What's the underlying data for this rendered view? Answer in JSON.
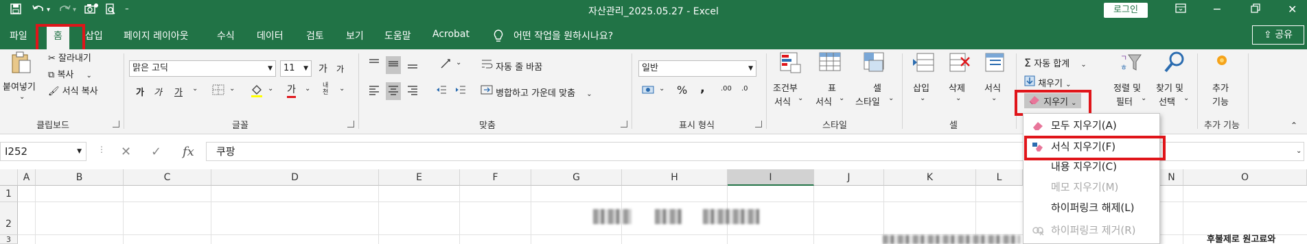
{
  "window": {
    "title": "자산관리_2025.05.27  -  Excel",
    "login_label": "로그인",
    "share_label": "공유"
  },
  "tabs": [
    "파일",
    "홈",
    "삽입",
    "페이지 레이아웃",
    "수식",
    "데이터",
    "검토",
    "보기",
    "도움말",
    "Acrobat"
  ],
  "tell_me": "어떤 작업을 원하시나요?",
  "ribbon": {
    "clipboard": {
      "paste": "붙여넣기",
      "cut": "잘라내기",
      "copy": "복사",
      "format_painter": "서식 복사",
      "label": "클립보드"
    },
    "font": {
      "name": "맑은 고딕",
      "size": "11",
      "grow": "가",
      "shrink": "가",
      "bold": "가",
      "italic": "가",
      "underline": "가",
      "font_color": "가",
      "phonetic": "내천",
      "label": "글꼴"
    },
    "alignment": {
      "wrap": "자동 줄 바꿈",
      "merge": "병합하고 가운데 맞춤",
      "label": "맞춤"
    },
    "number": {
      "format": "일반",
      "percent": "%",
      "comma": ",",
      "inc": ".00",
      "dec": ".0",
      "label": "표시 형식"
    },
    "styles": {
      "conditional": [
        "조건부",
        "서식"
      ],
      "table": [
        "표",
        "서식"
      ],
      "cell": [
        "셀",
        "스타일"
      ],
      "label": "스타일"
    },
    "cells": {
      "insert": "삽입",
      "delete": "삭제",
      "format": "서식",
      "label": "셀"
    },
    "editing": {
      "autosum": "자동 합계",
      "fill": "채우기",
      "clear": "지우기",
      "sort": [
        "정렬 및",
        "필터"
      ],
      "find": [
        "찾기 및",
        "선택"
      ]
    },
    "addins": {
      "button": [
        "추가",
        "기능"
      ],
      "label": "추가 기능"
    }
  },
  "formula_bar": {
    "name_box": "I252",
    "fx": "fx",
    "content": "쿠팡"
  },
  "columns": [
    "A",
    "B",
    "C",
    "D",
    "E",
    "F",
    "G",
    "H",
    "I",
    "J",
    "K",
    "L",
    "N",
    "O"
  ],
  "rows": [
    "1",
    "2",
    "3"
  ],
  "cell_text": "후불제로 원고료와",
  "clear_menu": {
    "items": [
      {
        "label": "모두 지우기(A)",
        "enabled": true
      },
      {
        "label": "서식 지우기(F)",
        "enabled": true
      },
      {
        "label": "내용 지우기(C)",
        "enabled": true
      },
      {
        "label": "메모 지우기(M)",
        "enabled": false
      },
      {
        "label": "하이퍼링크 해제(L)",
        "enabled": true
      },
      {
        "label": "하이퍼링크 제거(R)",
        "enabled": false
      }
    ]
  },
  "colors": {
    "excel_green": "#217346",
    "highlight_red": "#e0151a"
  }
}
